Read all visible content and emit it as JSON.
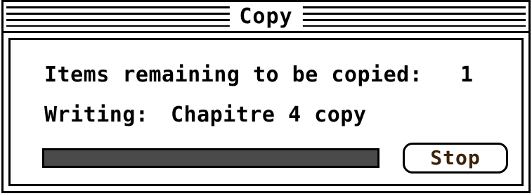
{
  "window": {
    "title": "Copy"
  },
  "status": {
    "items_label": "Items remaining to be copied:",
    "items_count": "1",
    "writing_label": "Writing:",
    "writing_file": "Chapitre 4 copy"
  },
  "progress": {
    "fraction": 1.0
  },
  "buttons": {
    "stop_label": "Stop"
  },
  "colors": {
    "progress_fill": "#4a4a4a",
    "stop_text": "#3b2208"
  }
}
